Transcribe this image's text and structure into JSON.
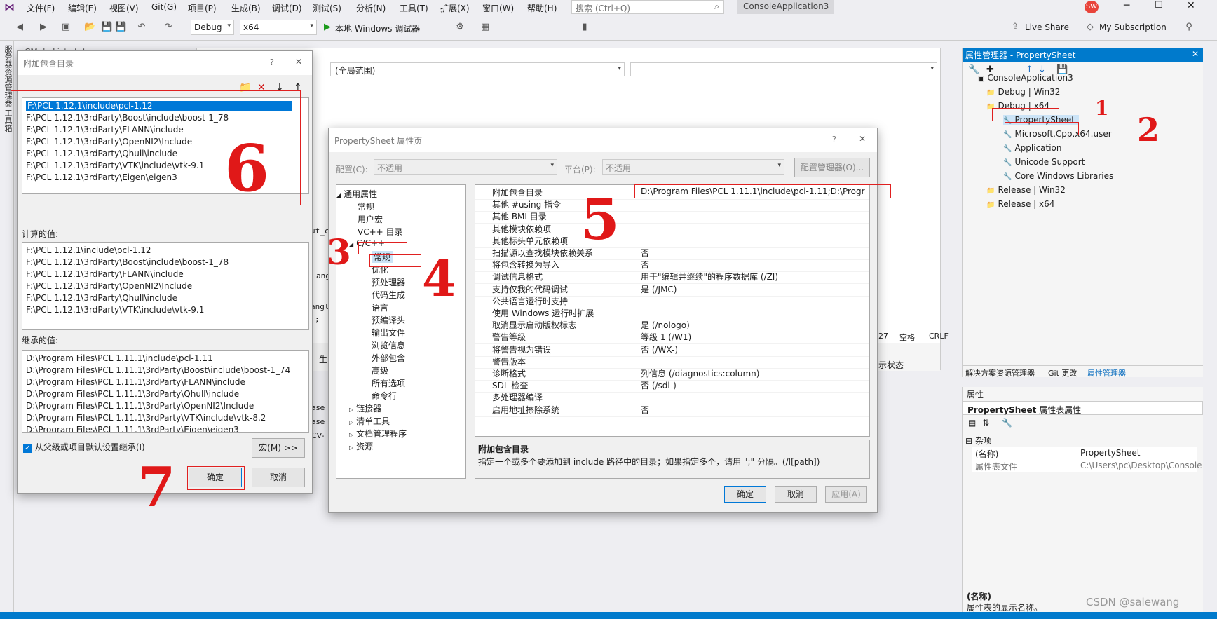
{
  "menu": [
    "文件(F)",
    "编辑(E)",
    "视图(V)",
    "Git(G)",
    "项目(P)",
    "生成(B)",
    "调试(D)",
    "测试(S)",
    "分析(N)",
    "工具(T)",
    "扩展(X)",
    "窗口(W)",
    "帮助(H)"
  ],
  "search_placeholder": "搜索 (Ctrl+Q)",
  "solution_name": "ConsoleApplication3",
  "user_initials": "SW",
  "toolbar": {
    "config": "Debug",
    "platform": "x64",
    "run_label": "本地 Windows 调试器",
    "live_share": "Live Share",
    "subscription": "My Subscription"
  },
  "left_dock": "服务器资源管理器  工具箱",
  "editor": {
    "tab1": "CMakeLists.txt",
    "tab2": "CMakeLists.txt",
    "scope": "(全局范围)",
    "line_info": "27",
    "spaces": "空格",
    "crlf": "CRLF",
    "frag1": "ut_c",
    "frag2": "ang",
    "frag3": "angl",
    "frag4": ";",
    "frag5": "示状态",
    "frag6": "ase",
    "frag7": "ase",
    "frag8": "CV-",
    "frag9": "生"
  },
  "prop_manager": {
    "title": "属性管理器 - PropertySheet",
    "root": "ConsoleApplication3",
    "items": [
      "Debug | Win32",
      "Debug | x64",
      "PropertySheet",
      "Microsoft.Cpp.x64.user",
      "Application",
      "Unicode Support",
      "Core Windows Libraries",
      "Release | Win32",
      "Release | x64"
    ],
    "tabs": [
      "解决方案资源管理器",
      "Git 更改",
      "属性管理器"
    ]
  },
  "props_panel": {
    "title": "属性",
    "header": "PropertySheet",
    "header_sub": "属性表属性",
    "group": "杂项",
    "rows": [
      {
        "k": "(名称)",
        "v": "PropertySheet"
      },
      {
        "k": "属性表文件",
        "v": "C:\\Users\\pc\\Desktop\\Console"
      }
    ],
    "desc_title": "(名称)",
    "desc": "属性表的显示名称。",
    "watermark": "CSDN @salewang"
  },
  "inc_dialog": {
    "title": "附加包含目录",
    "entries": [
      "F:\\PCL 1.12.1\\include\\pcl-1.12",
      "F:\\PCL 1.12.1\\3rdParty\\Boost\\include\\boost-1_78",
      "F:\\PCL 1.12.1\\3rdParty\\FLANN\\include",
      "F:\\PCL 1.12.1\\3rdParty\\OpenNI2\\Include",
      "F:\\PCL 1.12.1\\3rdParty\\Qhull\\include",
      "F:\\PCL 1.12.1\\3rdParty\\VTK\\include\\vtk-9.1",
      "F:\\PCL 1.12.1\\3rdParty\\Eigen\\eigen3"
    ],
    "computed_label": "计算的值:",
    "computed": [
      "F:\\PCL 1.12.1\\include\\pcl-1.12",
      "F:\\PCL 1.12.1\\3rdParty\\Boost\\include\\boost-1_78",
      "F:\\PCL 1.12.1\\3rdParty\\FLANN\\include",
      "F:\\PCL 1.12.1\\3rdParty\\OpenNI2\\Include",
      "F:\\PCL 1.12.1\\3rdParty\\Qhull\\include",
      "F:\\PCL 1.12.1\\3rdParty\\VTK\\include\\vtk-9.1"
    ],
    "inherited_label": "继承的值:",
    "inherited": [
      "D:\\Program Files\\PCL 1.11.1\\include\\pcl-1.11",
      "D:\\Program Files\\PCL 1.11.1\\3rdParty\\Boost\\include\\boost-1_74",
      "D:\\Program Files\\PCL 1.11.1\\3rdParty\\FLANN\\include",
      "D:\\Program Files\\PCL 1.11.1\\3rdParty\\Qhull\\include",
      "D:\\Program Files\\PCL 1.11.1\\3rdParty\\OpenNI2\\Include",
      "D:\\Program Files\\PCL 1.11.1\\3rdParty\\VTK\\include\\vtk-8.2",
      "D:\\Program Files\\PCL 1.11.1\\3rdParty\\Eigen\\eigen3"
    ],
    "inherit_check": "从父级或项目默认设置继承(I)",
    "macro_btn": "宏(M) >>",
    "ok": "确定",
    "cancel": "取消"
  },
  "ps_dialog": {
    "title": "PropertySheet 属性页",
    "config_label": "配置(C):",
    "config_val": "不适用",
    "platform_label": "平台(P):",
    "platform_val": "不适用",
    "config_mgr": "配置管理器(O)...",
    "nav": [
      {
        "t": "通用属性",
        "lvl": 0,
        "exp": "◢"
      },
      {
        "t": "常规",
        "lvl": 1
      },
      {
        "t": "用户宏",
        "lvl": 1
      },
      {
        "t": "VC++ 目录",
        "lvl": 1
      },
      {
        "t": "C/C++",
        "lvl": 1,
        "exp": "◢"
      },
      {
        "t": "常规",
        "lvl": 2,
        "sel": true
      },
      {
        "t": "优化",
        "lvl": 2
      },
      {
        "t": "预处理器",
        "lvl": 2
      },
      {
        "t": "代码生成",
        "lvl": 2
      },
      {
        "t": "语言",
        "lvl": 2
      },
      {
        "t": "预编译头",
        "lvl": 2
      },
      {
        "t": "输出文件",
        "lvl": 2
      },
      {
        "t": "浏览信息",
        "lvl": 2
      },
      {
        "t": "外部包含",
        "lvl": 2
      },
      {
        "t": "高级",
        "lvl": 2
      },
      {
        "t": "所有选项",
        "lvl": 2
      },
      {
        "t": "命令行",
        "lvl": 2
      },
      {
        "t": "链接器",
        "lvl": 1,
        "exp": "▷"
      },
      {
        "t": "清单工具",
        "lvl": 1,
        "exp": "▷"
      },
      {
        "t": "文档管理程序",
        "lvl": 1,
        "exp": "▷"
      },
      {
        "t": "资源",
        "lvl": 1,
        "exp": "▷"
      }
    ],
    "props": [
      {
        "k": "附加包含目录",
        "v": "D:\\Program Files\\PCL 1.11.1\\include\\pcl-1.11;D:\\Progr"
      },
      {
        "k": "其他 #using 指令",
        "v": ""
      },
      {
        "k": "其他 BMI 目录",
        "v": ""
      },
      {
        "k": "其他模块依赖项",
        "v": ""
      },
      {
        "k": "其他标头单元依赖项",
        "v": ""
      },
      {
        "k": "扫描源以查找模块依赖关系",
        "v": "否"
      },
      {
        "k": "将包含转换为导入",
        "v": "否"
      },
      {
        "k": "调试信息格式",
        "v": "用于\"编辑并继续\"的程序数据库 (/ZI)"
      },
      {
        "k": "支持仅我的代码调试",
        "v": "是 (/JMC)"
      },
      {
        "k": "公共语言运行时支持",
        "v": ""
      },
      {
        "k": "使用 Windows 运行时扩展",
        "v": ""
      },
      {
        "k": "取消显示启动版权标志",
        "v": "是 (/nologo)"
      },
      {
        "k": "警告等级",
        "v": "等级 1 (/W1)"
      },
      {
        "k": "将警告视为错误",
        "v": "否 (/WX-)"
      },
      {
        "k": "警告版本",
        "v": ""
      },
      {
        "k": "诊断格式",
        "v": "列信息 (/diagnostics:column)"
      },
      {
        "k": "SDL 检查",
        "v": "否 (/sdl-)"
      },
      {
        "k": "多处理器编译",
        "v": ""
      },
      {
        "k": "启用地址擦除系统",
        "v": "否"
      }
    ],
    "desc_title": "附加包含目录",
    "desc": "指定一个或多个要添加到 include 路径中的目录；如果指定多个，请用 \";\" 分隔。(/I[path])",
    "ok": "确定",
    "cancel": "取消",
    "apply": "应用(A)"
  },
  "annotations": [
    "1",
    "2",
    "3",
    "4",
    "5",
    "6",
    "7"
  ]
}
